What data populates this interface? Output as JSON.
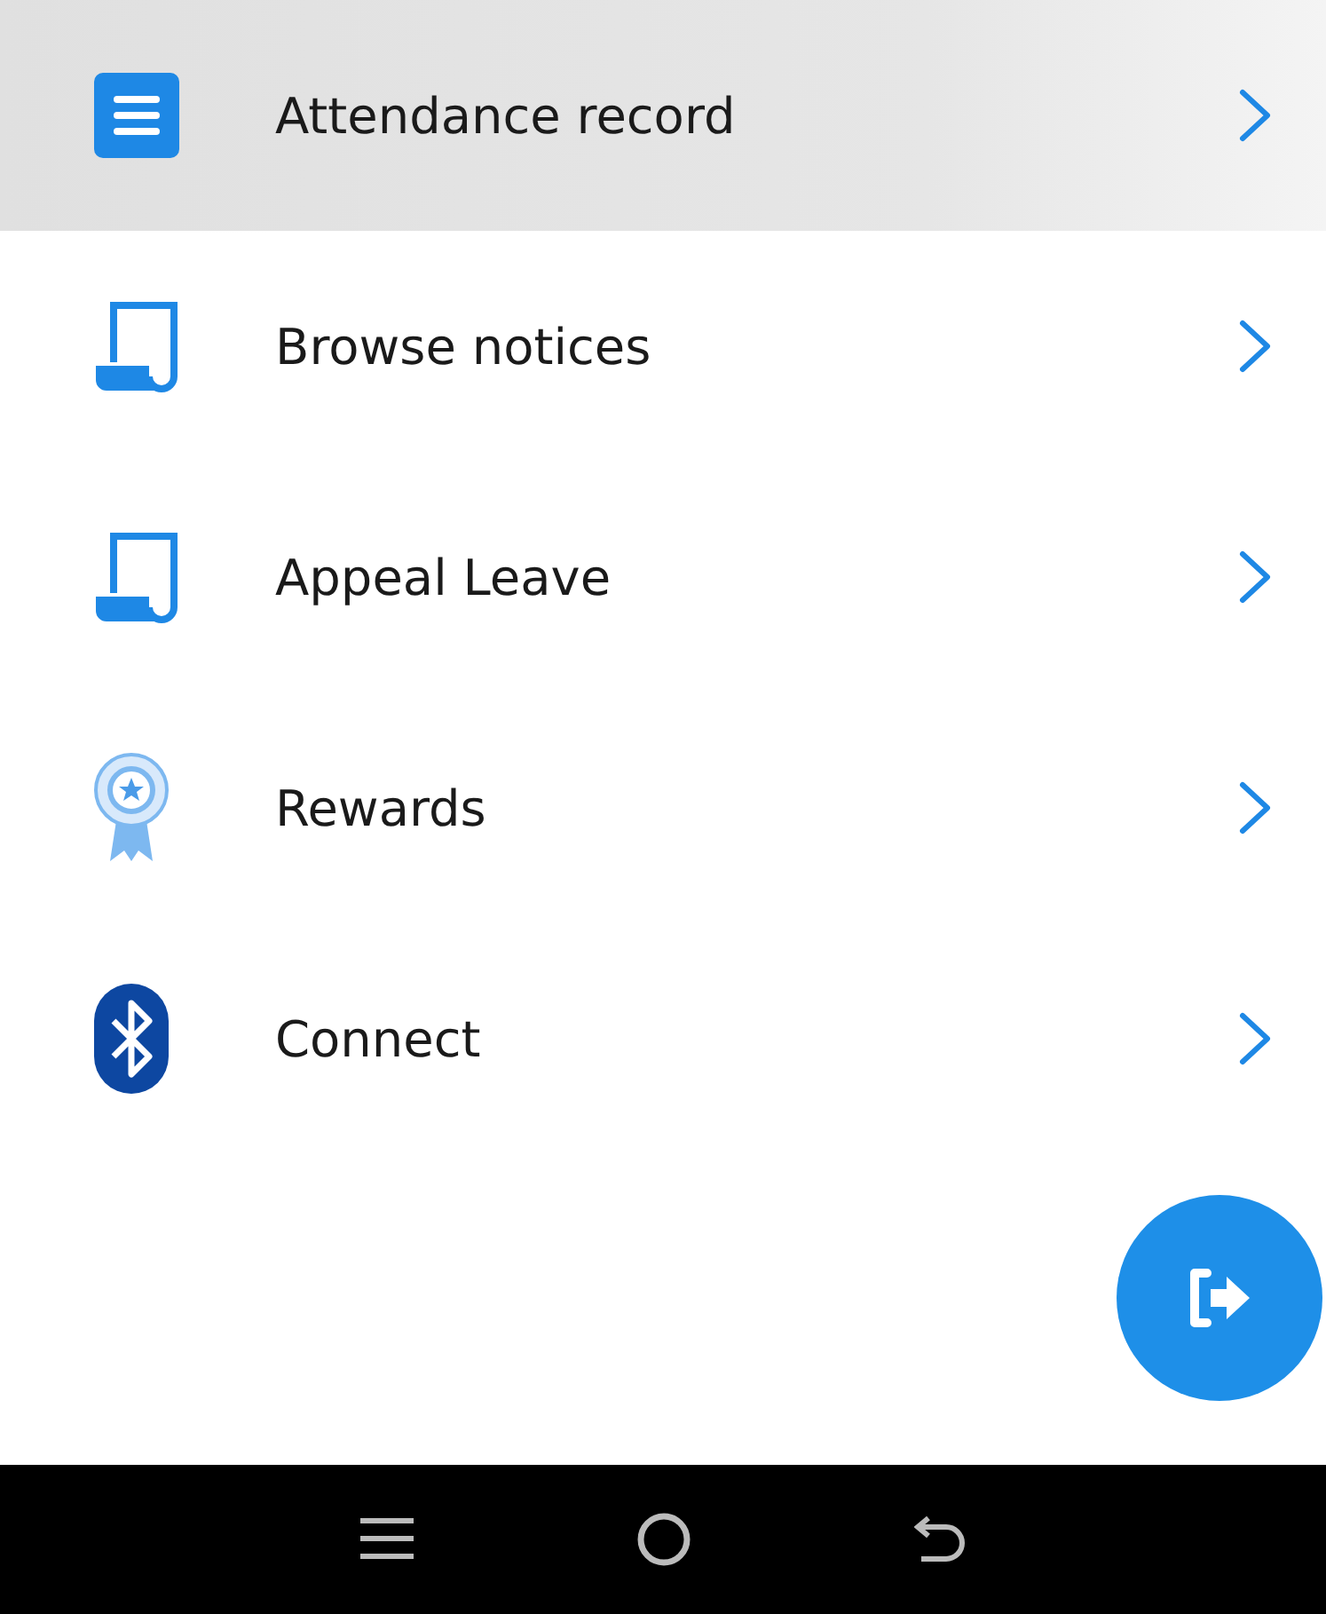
{
  "menu": [
    {
      "label": "Attendance record",
      "kind": "list",
      "selected": true
    },
    {
      "label": "Browse notices",
      "kind": "scroll",
      "selected": false
    },
    {
      "label": "Appeal Leave",
      "kind": "scroll",
      "selected": false
    },
    {
      "label": "Rewards",
      "kind": "award",
      "selected": false
    },
    {
      "label": "Connect",
      "kind": "bluetooth",
      "selected": false
    }
  ]
}
